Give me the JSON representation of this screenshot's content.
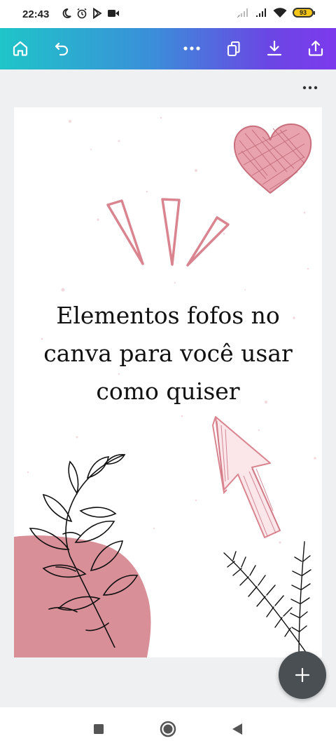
{
  "status_bar": {
    "time": "22:43",
    "battery": "93",
    "icons": [
      "moon-icon",
      "alarm-icon",
      "play-store-icon",
      "video-icon",
      "signal-weak-icon",
      "signal-icon",
      "wifi-icon",
      "battery-icon"
    ]
  },
  "toolbar": {
    "buttons": [
      "home-icon",
      "undo-icon",
      "more-icon",
      "copy-pages-icon",
      "download-icon",
      "share-icon"
    ]
  },
  "design": {
    "title_line1": "Elementos fofos no",
    "title_line2": "canva para você usar",
    "title_line3": "como quiser"
  },
  "colors": {
    "toolbar_start": "#1fc5c8",
    "toolbar_end": "#7c3aed",
    "accent_pink": "#d9848f",
    "fab_bg": "#4a4f54"
  },
  "fab": {
    "icon": "plus-icon"
  },
  "nav": {
    "icons": [
      "recent-apps-icon",
      "home-circle-icon",
      "back-icon"
    ]
  }
}
